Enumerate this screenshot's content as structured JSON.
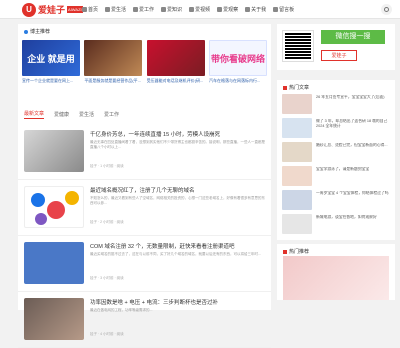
{
  "nav": {
    "logo_mark": "U",
    "logo_text": "爱娃子",
    "logo_badge": "AIWAZI",
    "items": [
      {
        "label": "首页",
        "icon": "home-icon"
      },
      {
        "label": "爱生活",
        "icon": "heart-icon"
      },
      {
        "label": "爱工作",
        "icon": "briefcase-icon"
      },
      {
        "label": "爱知识",
        "icon": "book-icon"
      },
      {
        "label": "爱视频",
        "icon": "video-icon"
      },
      {
        "label": "爱观察",
        "icon": "eye-icon"
      },
      {
        "label": "关于我",
        "icon": "user-icon"
      },
      {
        "label": "留言板",
        "icon": "message-icon"
      }
    ]
  },
  "recommend": {
    "title": "博主推荐",
    "items": [
      {
        "caption": "宣传一个企业就是要在网上..."
      },
      {
        "caption": "平面是服务就是要经营作品(平..."
      },
      {
        "caption": "受压器能对电话及继机评价(研..."
      },
      {
        "caption": "汽车在格落与在网落标内行..."
      }
    ],
    "r1_text": "企业 就是用",
    "r4_text": "带你看破网络"
  },
  "tabs": [
    "最新文章",
    "爱健康",
    "爱生活",
    "爱工作"
  ],
  "posts": [
    {
      "title": "千亿身价芳总，一年连续直播 15 小时，劳模人设崩死",
      "excerpt": "最近无事在四处直播间看了看，没想到其实他们不少带货博主也都挺辛苦的。接说明，那些直播，一些人一直都是直播八个小时以上...",
      "meta": "娃子 · 1 小时前 · 阅读"
    },
    {
      "title": "最近域名概况红了，注册了几个无聊的域名",
      "excerpt": "不知怎么的，最近又看到有些人了空域名，网络相关的投资的，心想一门这些老域名上，好像有着很多有意思的东西可以参...",
      "meta": "娃子 · 2 小时前 · 阅读"
    },
    {
      "title": "COM 域名注册 32 个，无数量限制，赶快来看看注册渠道吧",
      "excerpt": "最近买域名的挺不过去了，这在与以前不同，买了好几个域名的域名，就要以后还有的东西，可以将给三年时...",
      "meta": "娃子 · 3 小时前 · 阅读"
    },
    {
      "title": "功率因数是啥 + 电压 + 电流：三步判断杯也是否过补",
      "excerpt": "最近在做电网的工程，功率等级需求的...",
      "meta": "娃子 · 4 小时前 · 阅读"
    }
  ],
  "wechat": {
    "label": "微信搜一搜",
    "button": "爱娃子"
  },
  "hot": {
    "title": "热门文章",
    "items": [
      {
        "text": "26 年五月签专宣平，宝宝宝宝大了(后面)"
      },
      {
        "text": "做了 3 年，却总结出了适合研 18 哦的自己 2024 全年统计"
      },
      {
        "text": "婚纱汇总、烫脸已完，但宝宝新面的心得..."
      },
      {
        "text": "宝宝学游泳了，请是新题到宝宝"
      },
      {
        "text": "一周岁宝宝 4 个宝宝体检，你结体检过了吗"
      },
      {
        "text": "新城电游，谈宝在各地，如何观察好"
      }
    ]
  },
  "ad": {
    "title": "热门推荐"
  }
}
